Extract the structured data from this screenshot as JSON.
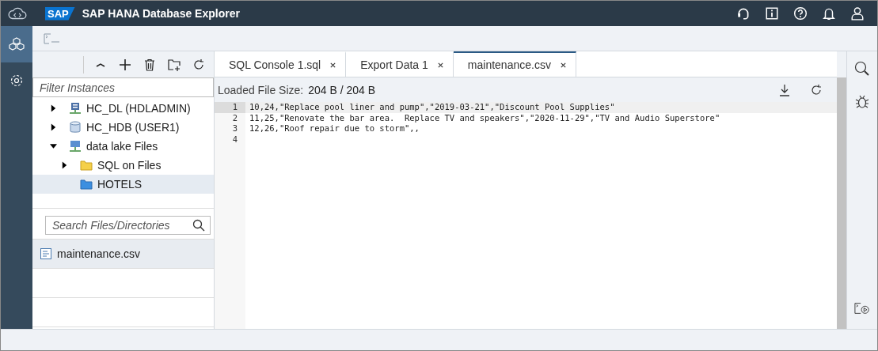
{
  "header": {
    "logo": "SAP",
    "title": "SAP HANA Database Explorer"
  },
  "rail": [
    {
      "kind": "database",
      "selected": true
    },
    {
      "kind": "settings",
      "selected": false
    }
  ],
  "tree_toolbar": {
    "filter": {
      "placeholder": "Filter Instances"
    }
  },
  "tree": [
    {
      "label": "HC_DL (HDLADMIN)",
      "kind": "server",
      "expanded": false,
      "selected": false
    },
    {
      "label": "HC_HDB (USER1)",
      "kind": "database",
      "expanded": false,
      "selected": false
    },
    {
      "label": "data lake Files",
      "kind": "network",
      "expanded": true,
      "selected": false,
      "children": [
        {
          "label": "SQL on Files",
          "kind": "folder-yellow",
          "expanded": false,
          "selected": false
        },
        {
          "label": "HOTELS",
          "kind": "folder-blue",
          "selected": true
        }
      ]
    }
  ],
  "file_search": {
    "placeholder": "Search Files/Directories"
  },
  "files": [
    {
      "name": "maintenance.csv",
      "selected": true
    }
  ],
  "tabs": [
    {
      "label": "SQL Console 1.sql",
      "selected": false
    },
    {
      "label": "Export Data 1",
      "selected": false
    },
    {
      "label": "maintenance.csv",
      "selected": true
    }
  ],
  "editor": {
    "size_label": "Loaded File Size:",
    "size_value": "204 B / 204 B",
    "lines": [
      {
        "number": "1",
        "text": "10,24,\"Replace pool liner and pump\",\"2019-03-21\",\"Discount Pool Supplies\"",
        "active": true
      },
      {
        "number": "2",
        "text": "11,25,\"Renovate the bar area.  Replace TV and speakers\",\"2020-11-29\",\"TV and Audio Superstore\"",
        "active": false
      },
      {
        "number": "3",
        "text": "12,26,\"Roof repair due to storm\",,",
        "active": false
      },
      {
        "number": "4",
        "active": false
      }
    ]
  }
}
